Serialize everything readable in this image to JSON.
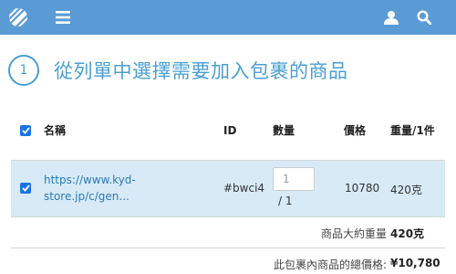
{
  "colors": {
    "topbar": "#5b9bd5",
    "accent": "#4a9fd3",
    "selected_row": "#d7eaf6",
    "checkbox": "#1a73e8",
    "link": "#2a7ab8"
  },
  "topbar": {
    "icons": [
      "logo-icon",
      "menu-icon",
      "user-icon",
      "search-icon"
    ]
  },
  "step": {
    "number": "1",
    "title": "從列單中選擇需要加入包裹的商品"
  },
  "table": {
    "headers": {
      "name": "名稱",
      "id": "ID",
      "qty": "數量",
      "price": "價格",
      "weight": "重量/1件"
    },
    "rows": [
      {
        "checked": true,
        "name": "https://www.kyd-store.jp/c/gen...",
        "id": "#bwci4",
        "qty_value": "1",
        "qty_total": "/ 1",
        "price": "10780",
        "weight": "420克"
      }
    ],
    "summary": {
      "weight_label": "商品大約重量",
      "weight_value": "420克",
      "total_label": "此包裹內商品的總價格:",
      "total_value": "¥10,780"
    }
  }
}
